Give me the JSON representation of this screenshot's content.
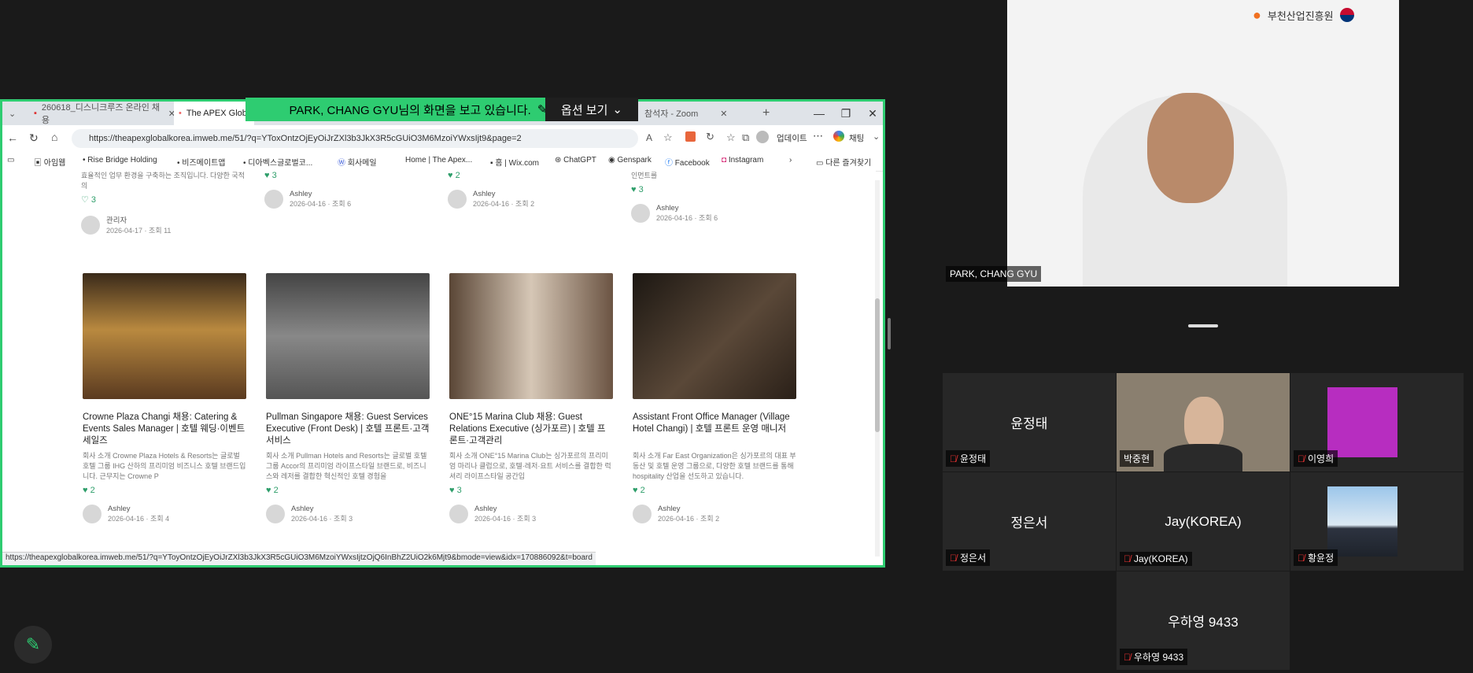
{
  "banner": {
    "text": "PARK, CHANG GYU님의 화면을 보고 있습니다.",
    "options_label": "옵션 보기"
  },
  "browser": {
    "tabs": [
      {
        "label": "260618_디스니크루즈 온라인 채용",
        "active": false
      },
      {
        "label": "The APEX Global",
        "active": true
      },
      {
        "label": "참석자 - Zoom",
        "active": false
      }
    ],
    "url": "https://theapexglobalkorea.imweb.me/51/?q=YToxOntzOjEyOiJrZXl3b3JkX3R5cGUiO3M6MzoiYWxsIjt9&page=2",
    "update_label": "업데이트",
    "chat_label": "채팅",
    "bookmarks": [
      "아임웹",
      "Rise Bridge Holding",
      "비즈메이트앱",
      "디아벡스글로벌코...",
      "회사메일",
      "Home | The Apex...",
      "홈 | Wix.com",
      "ChatGPT",
      "Genspark",
      "Facebook",
      "Instagram",
      "다른 즐겨찾기"
    ],
    "status_url": "https://theapexglobalkorea.imweb.me/51/?q=YToyOntzOjEyOiJrZXl3b3JkX3R5cGUiO3M6MzoiYWxsIjtzOjQ6InBhZ2UiO2k6Mjt9&bmode=view&idx=170886092&t=board"
  },
  "top_row": [
    {
      "desc": "효율적인 업무 환경을 구축하는 조직입니다. 다양한 국적의",
      "likes": "3",
      "author": "관리자",
      "meta": "2026-04-17 · 조회 11"
    },
    {
      "desc": "",
      "likes": "3",
      "author": "Ashley",
      "meta": "2026-04-16 · 조회 6"
    },
    {
      "desc": "",
      "likes": "2",
      "author": "Ashley",
      "meta": "2026-04-16 · 조회 2"
    },
    {
      "desc": "인먼트를",
      "likes": "3",
      "author": "Ashley",
      "meta": "2026-04-16 · 조회 6"
    }
  ],
  "cards": [
    {
      "title": "Crowne Plaza Changi 채용: Catering & Events Sales Manager | 호텔 웨딩·이벤트 세일즈",
      "desc": "회사 소개 Crowne Plaza Hotels & Resorts는 글로벌 호텔 그룹 IHG 산하의 프리미엄 비즈니스 호텔 브랜드입니다. 근무지는 Crowne P",
      "likes": "2",
      "author": "Ashley",
      "meta": "2026-04-16 · 조회 4"
    },
    {
      "title": "Pullman Singapore 채용: Guest Services Executive (Front Desk) | 호텔 프론트·고객서비스",
      "desc": "회사 소개 Pullman Hotels and Resorts는 글로벌 호텔 그룹 Accor의 프리미엄 라이프스타일 브랜드로, 비즈니스와 레저를 결합한 혁신적인 호텔 경험을",
      "likes": "2",
      "author": "Ashley",
      "meta": "2026-04-16 · 조회 3"
    },
    {
      "title": "ONE°15 Marina Club 채용: Guest Relations Executive (싱가포르) | 호텔 프론트·고객관리",
      "desc": "회사 소개 ONE°15 Marina Club는 싱가포르의 프리미엄 마리나 클럽으로, 호텔·레저·요트 서비스를 결합한 럭셔리 라이프스타일 공간입",
      "likes": "3",
      "author": "Ashley",
      "meta": "2026-04-16 · 조회 3"
    },
    {
      "title": "Assistant Front Office Manager (Village Hotel Changi) | 호텔 프론트 운영 매니저",
      "desc": "회사 소개 Far East Organization은 싱가포르의 대표 부동산 및 호텔 운영 그룹으로, 다양한 호텔 브랜드를 통해 hospitality 산업을 선도하고 있습니다.",
      "likes": "2",
      "author": "Ashley",
      "meta": "2026-04-16 · 조회 2"
    }
  ],
  "zoom": {
    "speaker_name": "PARK, CHANG GYU",
    "logo_text": "부천산업진흥원",
    "participants": [
      {
        "big": "윤정태",
        "tag": "윤정태",
        "muted": true
      },
      {
        "big": "",
        "tag": "박중현",
        "muted": false
      },
      {
        "big": "",
        "tag": "이영희",
        "muted": true
      },
      {
        "big": "정은서",
        "tag": "정은서",
        "muted": true
      },
      {
        "big": "Jay(KOREA)",
        "tag": "Jay(KOREA)",
        "muted": true
      },
      {
        "big": "",
        "tag": "황윤정",
        "muted": true
      },
      {
        "big": "우하영 9433",
        "tag": "우하영 9433",
        "muted": true
      }
    ]
  },
  "colors": {
    "share_border": "#2ecc71",
    "like": "#2e9e6a",
    "tile": "#272727"
  }
}
